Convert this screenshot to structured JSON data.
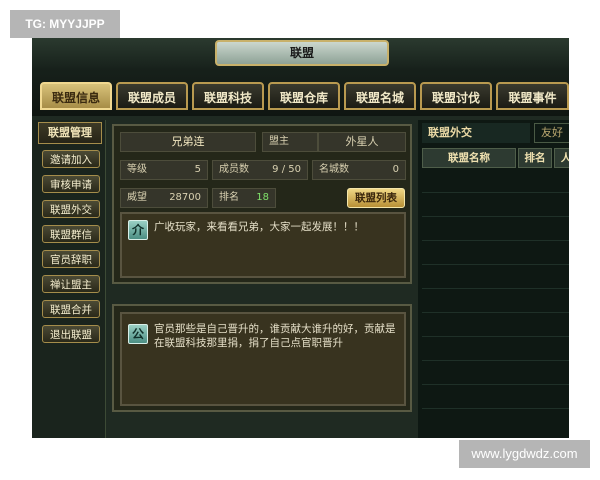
{
  "watermarks": {
    "top": "TG: MYYJJPP",
    "bottom": "www.lygdwdz.com"
  },
  "window": {
    "title": "联盟"
  },
  "tabs": [
    {
      "label": "联盟信息",
      "active": true
    },
    {
      "label": "联盟成员"
    },
    {
      "label": "联盟科技"
    },
    {
      "label": "联盟仓库"
    },
    {
      "label": "联盟名城"
    },
    {
      "label": "联盟讨伐"
    },
    {
      "label": "联盟事件"
    }
  ],
  "sidebar": {
    "title": "联盟管理",
    "items": [
      {
        "label": "邀请加入"
      },
      {
        "label": "审核申请"
      },
      {
        "label": "联盟外交"
      },
      {
        "label": "联盟群信"
      },
      {
        "label": "官员辞职"
      },
      {
        "label": "禅让盟主"
      },
      {
        "label": "联盟合并"
      },
      {
        "label": "退出联盟"
      }
    ]
  },
  "info": {
    "name": "兄弟连",
    "leader_label": "盟主",
    "leader_value": "外星人",
    "level_label": "等级",
    "level_value": "5",
    "members_label": "成员数",
    "members_value": "9 / 50",
    "cities_label": "名城数",
    "cities_value": "0",
    "prestige_label": "威望",
    "prestige_value": "28700",
    "rank_label": "排名",
    "rank_value": "18",
    "list_button": "联盟列表",
    "intro_badge": "介",
    "intro_text": "广收玩家，来看看兄弟，大家一起发展！！！"
  },
  "notice": {
    "badge": "公",
    "line1": "官员那些是自己晋升的，谁贡献大谁升的好，贡献是",
    "line2": "在联盟科技那里捐，捐了自己点官职晋升"
  },
  "diplomacy": {
    "title": "联盟外交",
    "tab": "友好",
    "col_name": "联盟名称",
    "col_rank": "排名",
    "col_extra": "人"
  },
  "colors": {
    "accent_gold": "#c8a85a",
    "active_tab": "#d8c27a",
    "rank_green": "#7fe06a"
  }
}
